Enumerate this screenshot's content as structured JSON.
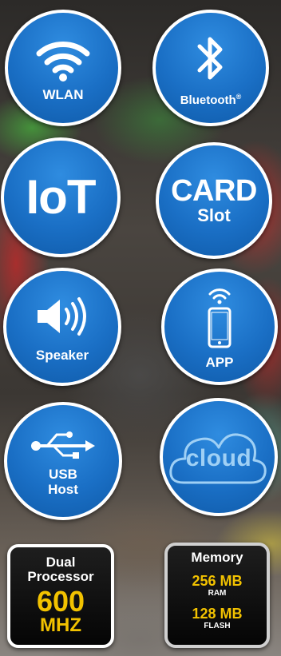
{
  "colors": {
    "badge_blue": "#1a6fc5",
    "badge_border": "#ffffff",
    "accent_yellow": "#f2c200",
    "cloud_text": "#9fd0f5"
  },
  "badges": {
    "wlan": {
      "label": "WLAN",
      "icon": "wifi-icon"
    },
    "bluetooth": {
      "label": "Bluetooth",
      "mark": "®",
      "icon": "bluetooth-icon"
    },
    "iot": {
      "label": "IoT"
    },
    "card": {
      "line1": "CARD",
      "line2": "Slot"
    },
    "speaker": {
      "label": "Speaker",
      "icon": "speaker-icon"
    },
    "app": {
      "label": "APP",
      "icon": "smartphone-wifi-icon"
    },
    "usb": {
      "line1": "USB",
      "line2": "Host",
      "icon": "usb-icon"
    },
    "cloud": {
      "label": "cloud",
      "icon": "cloud-icon"
    }
  },
  "processor": {
    "line1": "Dual",
    "line2": "Processor",
    "value": "600",
    "unit": "MHZ"
  },
  "memory": {
    "title": "Memory",
    "ram_value": "256 MB",
    "ram_label": "RAM",
    "flash_value": "128 MB",
    "flash_label": "FLASH"
  }
}
